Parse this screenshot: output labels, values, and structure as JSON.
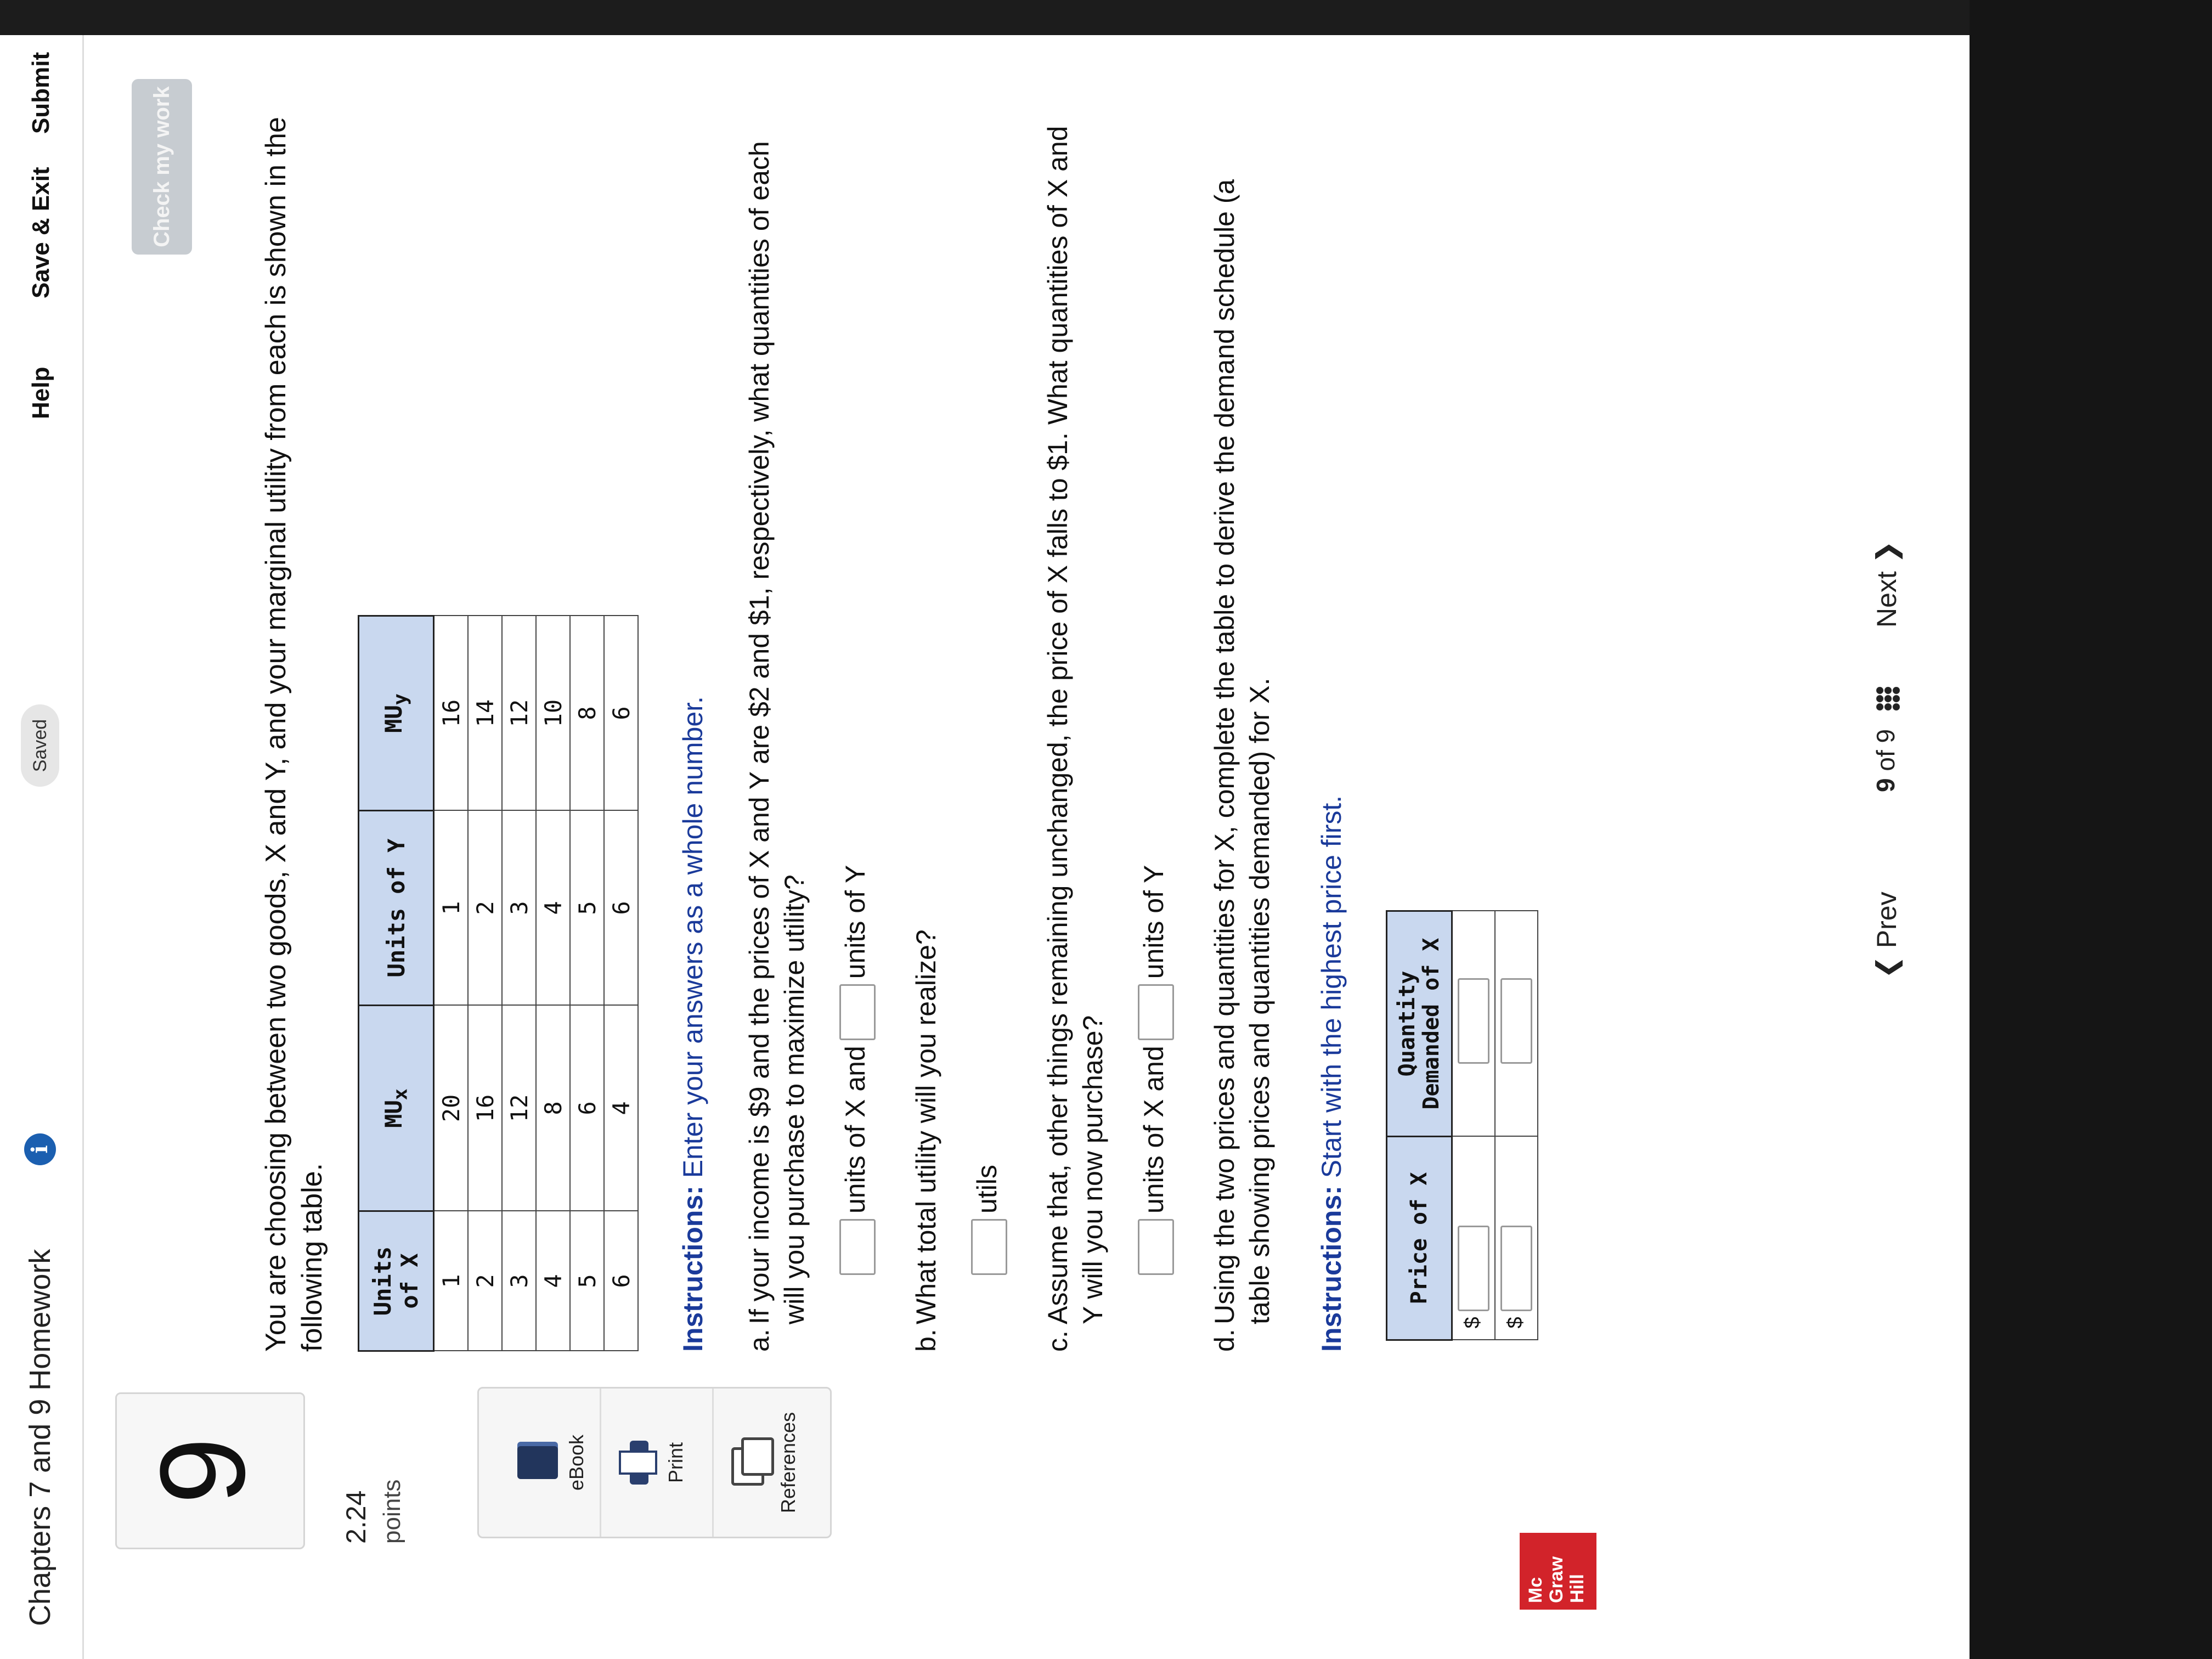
{
  "header": {
    "title": "Chapters 7 and 9 Homework",
    "info_icon": "i",
    "saved": "Saved",
    "help": "Help",
    "save_exit": "Save & Exit",
    "submit": "Submit",
    "check_work": "Check my work"
  },
  "sidebar": {
    "question_number": "9",
    "points_value": "2.24",
    "points_label": "points",
    "tools": [
      {
        "label": "eBook",
        "icon": "book-icon"
      },
      {
        "label": "Print",
        "icon": "printer-icon"
      },
      {
        "label": "References",
        "icon": "copy-icon"
      }
    ],
    "logo_lines": [
      "Mc",
      "Graw",
      "Hill"
    ]
  },
  "question": {
    "intro": "You are choosing between two goods, X and Y, and your marginal utility from each is shown in the following table.",
    "utility_table": {
      "headers": [
        "Units of X",
        "MUx",
        "Units of Y",
        "MUy"
      ],
      "rows": [
        [
          "1",
          "20",
          "1",
          "16"
        ],
        [
          "2",
          "16",
          "2",
          "14"
        ],
        [
          "3",
          "12",
          "3",
          "12"
        ],
        [
          "4",
          "8",
          "4",
          "10"
        ],
        [
          "5",
          "6",
          "5",
          "8"
        ],
        [
          "6",
          "4",
          "6",
          "6"
        ]
      ]
    },
    "instructions_label": "Instructions:",
    "instructions_1": " Enter your answers as a whole number.",
    "part_a": {
      "letter": "a.",
      "text": "If your income is $9 and the prices of X and Y are $2 and $1, respectively, what quantities of each will you purchase to maximize utility?",
      "unit_x": "units of X and",
      "unit_y": "units of Y"
    },
    "part_b": {
      "letter": "b.",
      "text": "What total utility will you realize?",
      "unit": "utils"
    },
    "part_c": {
      "letter": "c.",
      "text": "Assume that, other things remaining unchanged, the price of X falls to $1. What quantities of X and Y will you now purchase?",
      "unit_x": "units of X and",
      "unit_y": "units of Y"
    },
    "part_d": {
      "letter": "d.",
      "text": "Using the two prices and quantities for X, complete the table to derive the demand schedule (a table showing prices and quantities demanded) for X."
    },
    "instructions_2": " Start with the highest price first.",
    "demand_table": {
      "header_price": "Price of X",
      "header_qty_1": "Quantity",
      "header_qty_2": "Demanded of X",
      "currency": "$"
    }
  },
  "footer": {
    "prev": "Prev",
    "page_current": "9",
    "page_of": "of",
    "page_total": "9",
    "next": "Next"
  }
}
